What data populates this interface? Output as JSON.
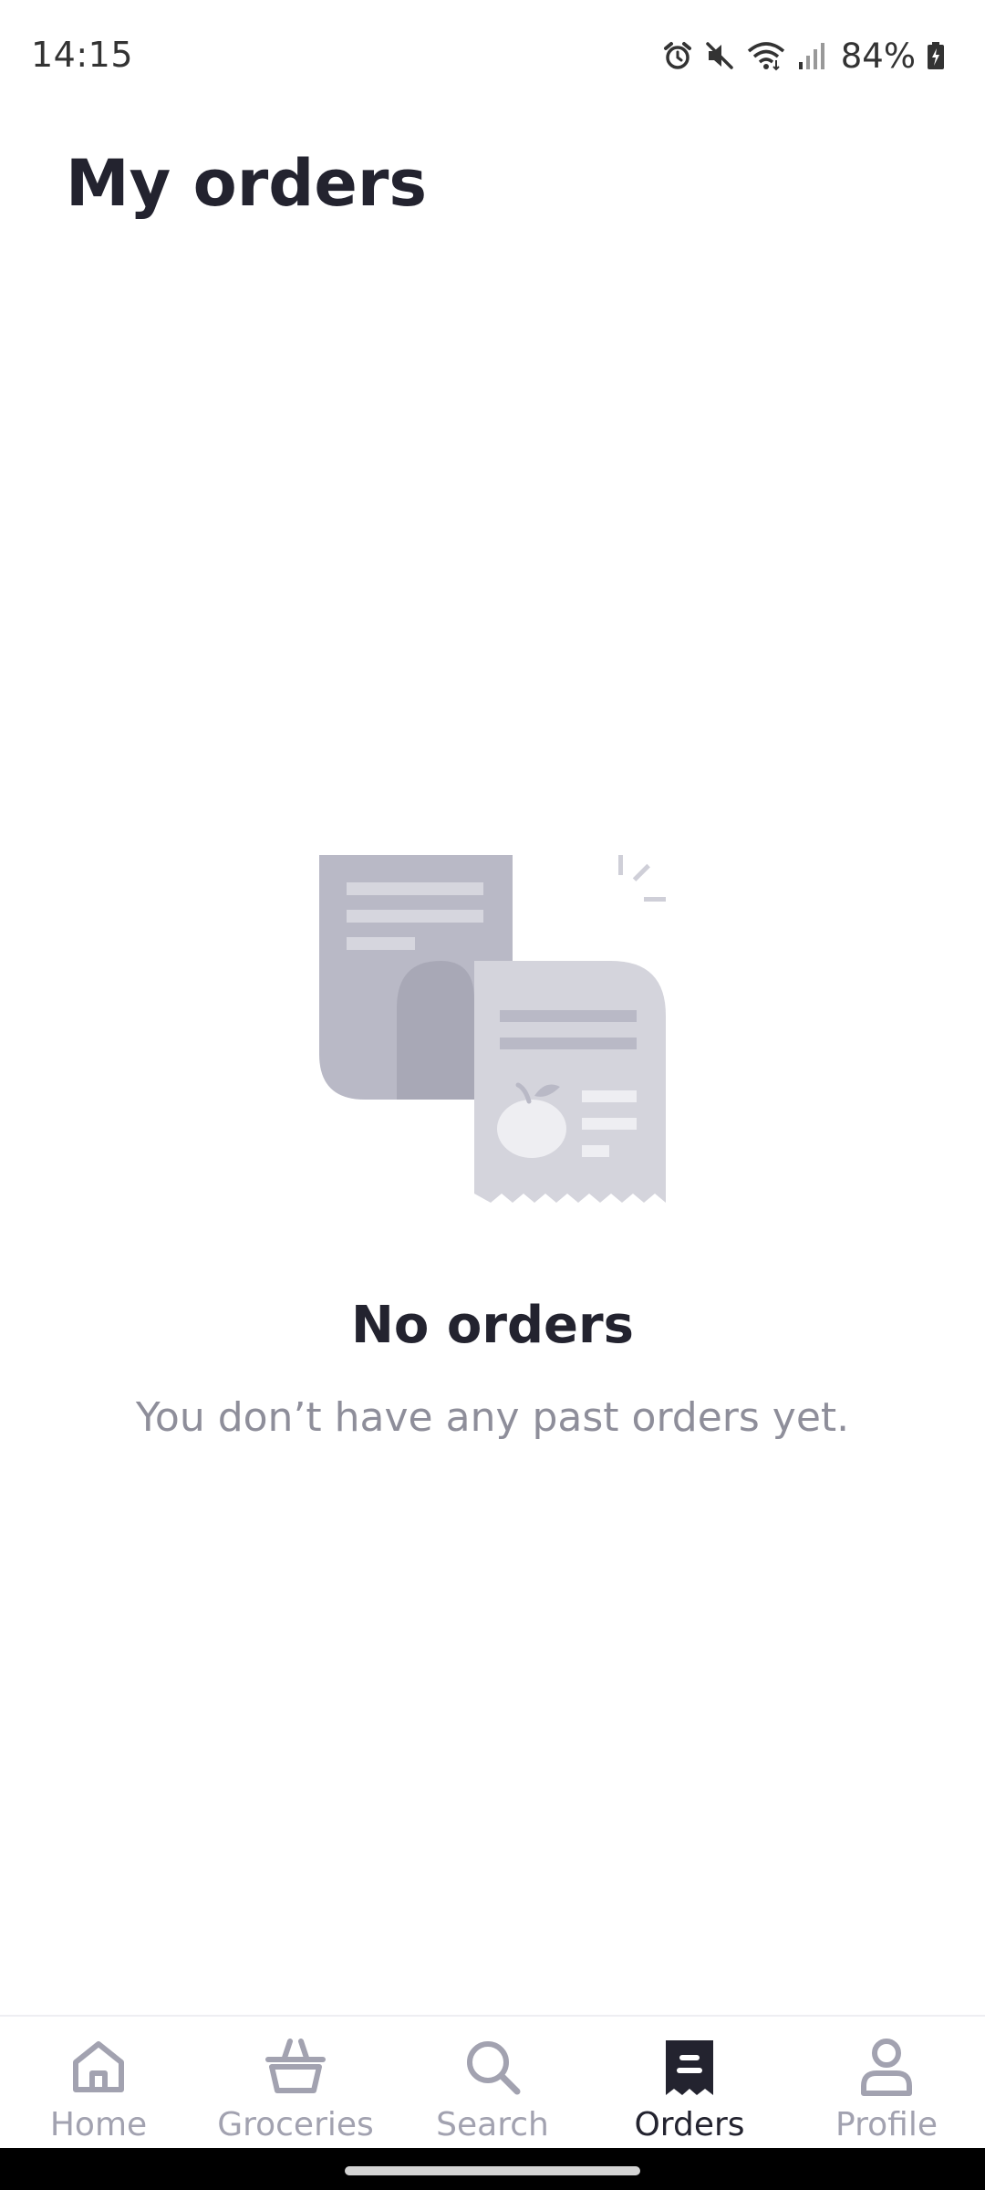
{
  "status_bar": {
    "time": "14:15",
    "battery_percent": "84%",
    "icons": [
      "alarm-icon",
      "mute-icon",
      "wifi-icon",
      "signal-icon",
      "battery-charging-icon"
    ]
  },
  "page": {
    "title": "My orders"
  },
  "empty_state": {
    "illustration": "receipts-illustration",
    "title": "No orders",
    "subtitle": "You don’t have any past orders yet."
  },
  "bottom_nav": {
    "items": [
      {
        "label": "Home",
        "icon": "home-icon",
        "active": false
      },
      {
        "label": "Groceries",
        "icon": "basket-icon",
        "active": false
      },
      {
        "label": "Search",
        "icon": "search-icon",
        "active": false
      },
      {
        "label": "Orders",
        "icon": "receipt-icon",
        "active": true
      },
      {
        "label": "Profile",
        "icon": "profile-icon",
        "active": false
      }
    ]
  },
  "colors": {
    "text_primary": "#23232f",
    "text_secondary": "#8e8e9a",
    "nav_inactive": "#a2a2b0",
    "illustration_dark": "#b9b9c6",
    "illustration_light": "#d4d4dc"
  }
}
